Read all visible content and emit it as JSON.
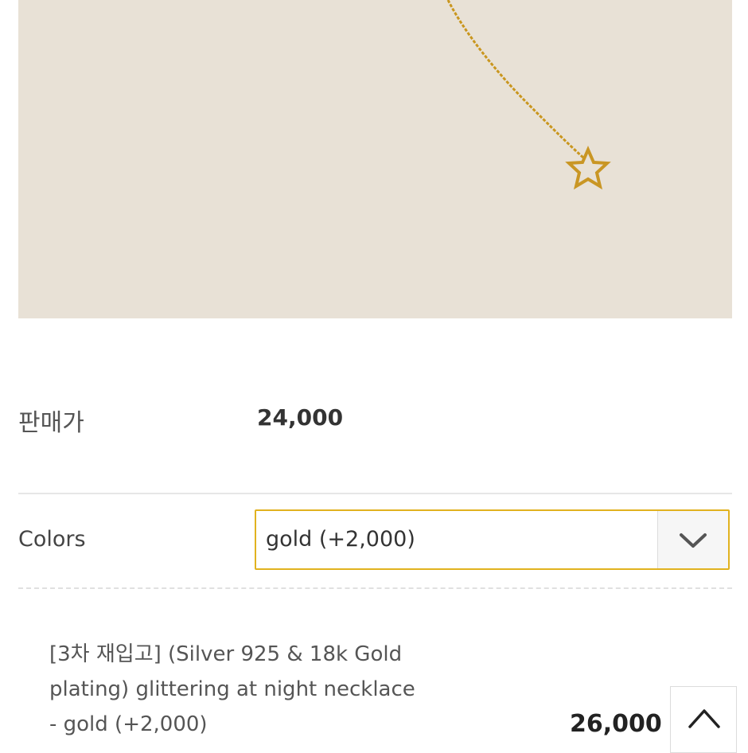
{
  "product": {
    "image_alt": "",
    "sale_price_label": "판매가",
    "sale_price_value": "24,000"
  },
  "options": {
    "colors_label": "Colors",
    "selected_value": "gold (+2,000)",
    "dropdown_icon": "chevron-down-icon"
  },
  "selected_item": {
    "name_lines": [
      "[3차 재입고] (Silver 925 & 18k Gold",
      "plating) glittering at night necklace",
      "- gold (+2,000)"
    ],
    "price": "26,000"
  },
  "scroll_top": {
    "icon": "chevron-up-icon"
  },
  "colors": {
    "accent": "#e1b21f",
    "photo_bg": "#e8e1d6",
    "chain": "#c9961e"
  }
}
